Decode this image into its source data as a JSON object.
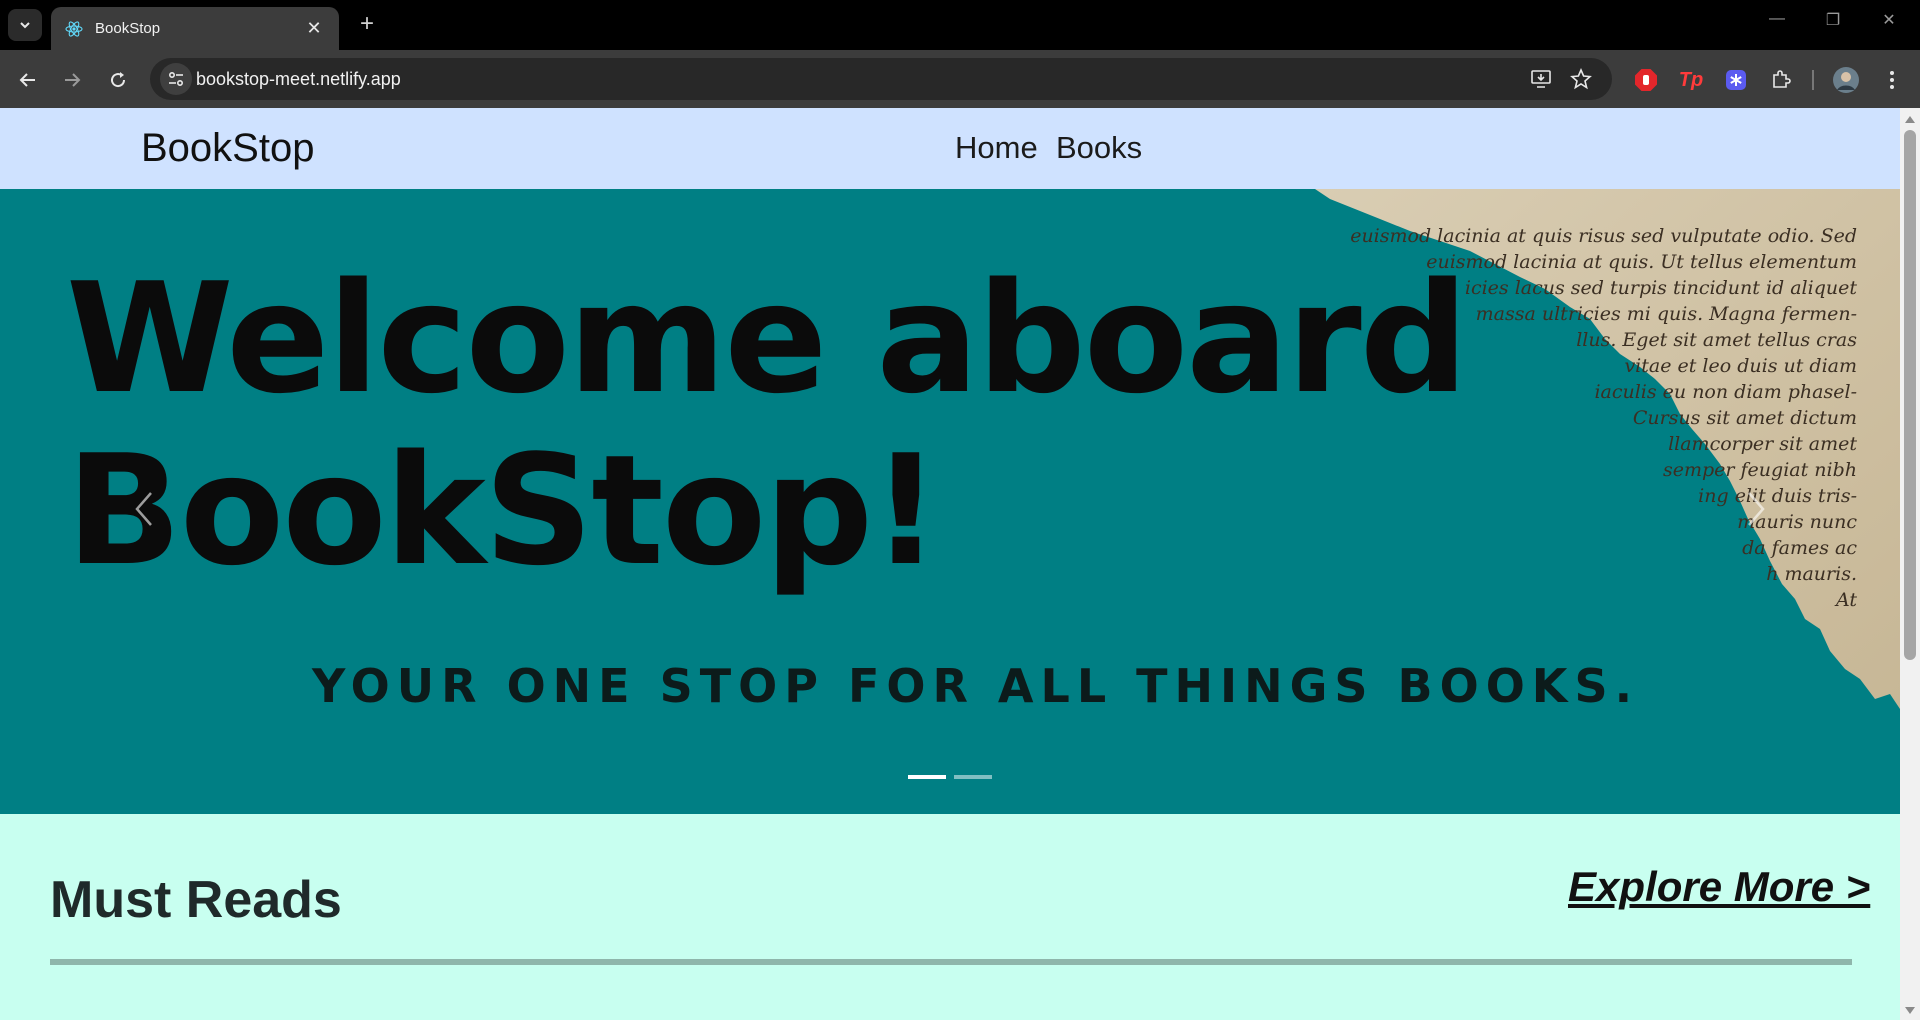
{
  "browser": {
    "tab_title": "BookStop",
    "tab_close": "✕",
    "new_tab": "+",
    "url": "bookstop-meet.netlify.app",
    "window_controls": {
      "minimize": "—",
      "restore": "❐",
      "close": "✕"
    },
    "extensions": [
      "stop-hand-icon",
      "tp-icon",
      "asterisk-icon",
      "puzzle-icon"
    ],
    "extension_tp_label": "Tp"
  },
  "site": {
    "brand": "BookStop",
    "nav": [
      "Home",
      "Books"
    ]
  },
  "carousel": {
    "headline_line1": "Welcome aboard",
    "headline_line2": "BookStop!",
    "tagline": "YOUR ONE STOP FOR ALL THINGS BOOKS.",
    "slides": 2,
    "active_slide": 1,
    "paper_text": [
      "euismod lacinia at quis risus sed vulputate odio. Sed",
      "euismod lacinia at quis. Ut tellus elementum",
      "icies lacus sed turpis tincidunt id aliquet",
      "massa ultricies mi quis. Magna fermen-",
      "llus. Eget sit amet tellus cras",
      "vitae et leo duis ut diam",
      "iaculis eu non diam phasel-",
      "Cursus sit amet dictum",
      "llamcorper sit amet",
      "semper feugiat nibh",
      "ing elit duis tris-",
      "mauris nunc",
      "da fames ac",
      "h mauris.",
      "At"
    ]
  },
  "must_reads": {
    "title": "Must Reads",
    "explore": "Explore More >"
  },
  "colors": {
    "navbar_bg": "#cfe2ff",
    "carousel_bg": "#007f84",
    "page_bg": "#c8fff0",
    "divider": "#8fb6ab"
  }
}
